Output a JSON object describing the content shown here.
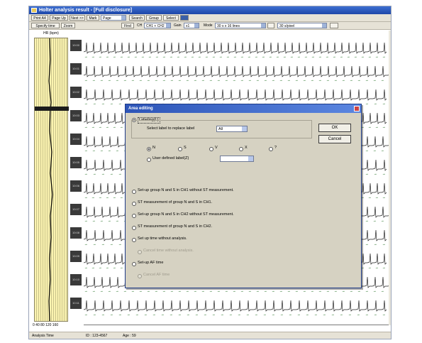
{
  "window": {
    "title": "Holter analysis result - [Full disclosure]"
  },
  "toolbar1": [
    {
      "label": "Print A4"
    },
    {
      "label": "Page Up"
    },
    {
      "label": "Next >>"
    },
    {
      "label": "Mark"
    },
    {
      "label": "Search"
    },
    {
      "label": "Group"
    },
    {
      "label": "Select"
    }
  ],
  "toolbar1_select": "Page",
  "toolbar2": {
    "btn1": "Specify time",
    "btn2": "Zoom",
    "btn3": "Find",
    "ch_label": "CH",
    "ch_value": "CH1 + CH2",
    "gain_label": "Gain",
    "gain_value": "x1",
    "mode_label": "Mode",
    "mode_value": "30 s x 16 lines",
    "zoom_value": "30 s/pixel"
  },
  "trend": {
    "title": "HR (bpm)",
    "axis_label": "0  40  80  120  160"
  },
  "time_labels": [
    "10:00",
    "10:01",
    "10:02",
    "10:03",
    "10:04",
    "10:05",
    "10:06",
    "10:07",
    "10:08",
    "10:09",
    "10:10",
    "10:11"
  ],
  "status": {
    "item1": "Analysis Time",
    "item2": "ID : 123-4567",
    "item3": "Age : 59"
  },
  "dialog": {
    "title": "Area editing",
    "labeling": "Labeling(L)",
    "select_label_text": "Select label to replace label",
    "select_label_value": "All",
    "label_options": [
      "N",
      "S",
      "V",
      "X",
      "?"
    ],
    "user_defined": "User defined label(Z)",
    "user_defined_value": "",
    "options": [
      "Set-up group N and S in CH1 without ST measurement.",
      "ST measurement of group N and S in CH1.",
      "Set-up group N and S in CH2 without ST measurement.",
      "ST measurement of group N and S in CH2.",
      "Set up time without analysis."
    ],
    "cancel_time": "Cancel time without analysis.",
    "setup_af": "Set-up AF time",
    "cancel_af": "Cancel AF time",
    "ok": "OK",
    "cancel": "Cancel"
  }
}
